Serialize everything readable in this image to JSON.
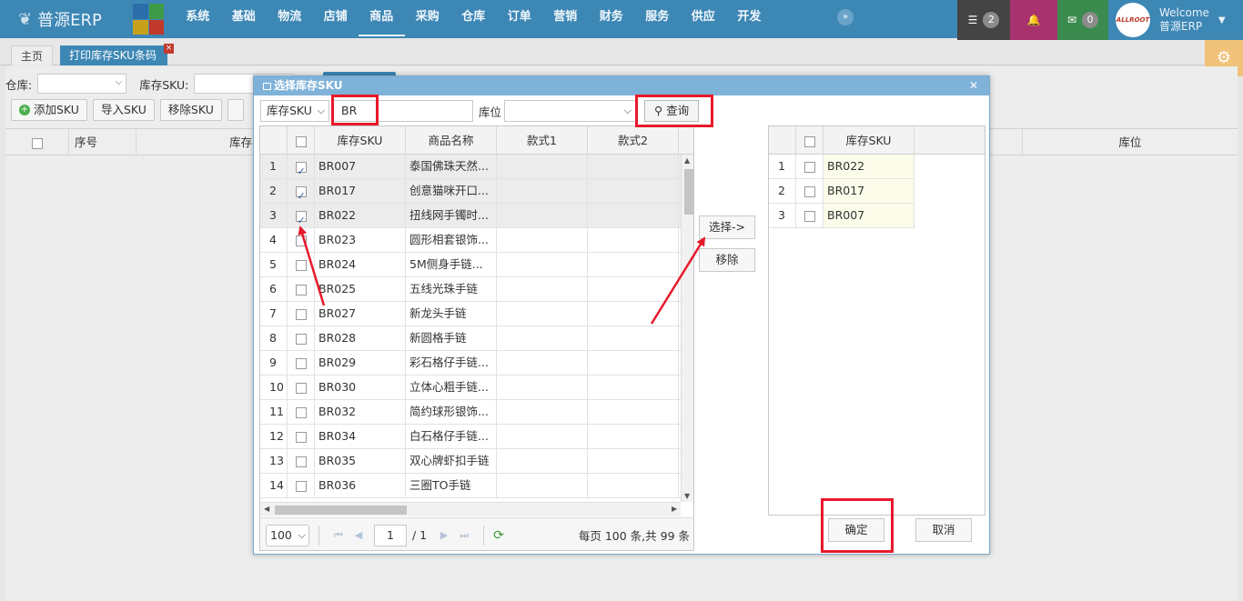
{
  "app": {
    "logo": "普源ERP"
  },
  "nav": {
    "items": [
      "系统",
      "基础",
      "物流",
      "店铺",
      "商品",
      "采购",
      "仓库",
      "订单",
      "营销",
      "财务",
      "服务",
      "供应",
      "开发"
    ],
    "active_index": 4
  },
  "topright": {
    "msg_count": "2",
    "mail_count": "0",
    "avatar_text": "ALLROOT",
    "welcome": "Welcome",
    "user": "普源ERP"
  },
  "tabs": {
    "home": "主页",
    "print": "打印库存SKU条码"
  },
  "bg": {
    "warehouse_label": "仓库:",
    "sku_label": "库存SKU:",
    "add_sku": "添加SKU",
    "import_sku": "导入SKU",
    "remove_sku": "移除SKU",
    "col_seq": "序号",
    "col_sku_part": "库存",
    "col_location": "库位"
  },
  "modal": {
    "title": "选择库存SKU",
    "search_field": "库存SKU",
    "search_value": "BR",
    "location_label": "库位",
    "query_button": "查询",
    "columns": {
      "sku": "库存SKU",
      "name": "商品名称",
      "style1": "款式1",
      "style2": "款式2"
    },
    "rows": [
      {
        "n": "1",
        "sku": "BR007",
        "name": "泰国佛珠天然...",
        "checked": true
      },
      {
        "n": "2",
        "sku": "BR017",
        "name": "创意猫咪开口...",
        "checked": true
      },
      {
        "n": "3",
        "sku": "BR022",
        "name": "扭线网手镯时...",
        "checked": true
      },
      {
        "n": "4",
        "sku": "BR023",
        "name": "圆形相套银饰...",
        "checked": false
      },
      {
        "n": "5",
        "sku": "BR024",
        "name": "5M侧身手链...",
        "checked": false
      },
      {
        "n": "6",
        "sku": "BR025",
        "name": "五线光珠手链",
        "checked": false
      },
      {
        "n": "7",
        "sku": "BR027",
        "name": "新龙头手链",
        "checked": false
      },
      {
        "n": "8",
        "sku": "BR028",
        "name": "新圆格手链",
        "checked": false
      },
      {
        "n": "9",
        "sku": "BR029",
        "name": "彩石格仔手链...",
        "checked": false
      },
      {
        "n": "10",
        "sku": "BR030",
        "name": "立体心粗手链...",
        "checked": false
      },
      {
        "n": "11",
        "sku": "BR032",
        "name": "简约球形银饰...",
        "checked": false
      },
      {
        "n": "12",
        "sku": "BR034",
        "name": "白石格仔手链...",
        "checked": false
      },
      {
        "n": "13",
        "sku": "BR035",
        "name": "双心牌虾扣手链",
        "checked": false
      },
      {
        "n": "14",
        "sku": "BR036",
        "name": "三圈TO手链",
        "checked": false
      }
    ],
    "pager": {
      "page_size": "100",
      "page": "1",
      "total_pages": "/ 1",
      "info": "每页 100 条,共 99 条"
    },
    "select_button": "选择->",
    "remove_button": "移除",
    "right_column": "库存SKU",
    "right_rows": [
      {
        "n": "1",
        "sku": "BR022"
      },
      {
        "n": "2",
        "sku": "BR017"
      },
      {
        "n": "3",
        "sku": "BR007"
      }
    ],
    "ok_button": "确定",
    "cancel_button": "取消"
  },
  "colors": {
    "nav_bg": "#3d87b5",
    "highlight": "#e8192c",
    "title_bar": "#7fb2d8"
  }
}
